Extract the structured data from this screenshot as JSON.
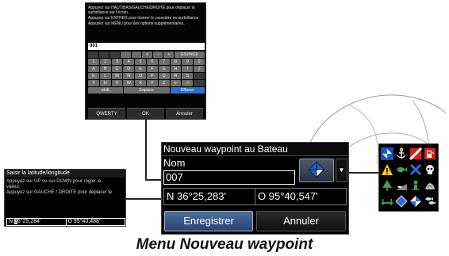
{
  "keyboard_panel": {
    "help": [
      "Appuyez sur HAUT/BAS/GAUCHE/DROITE pour déplacer la surbrillance sur l'écran.",
      "Appuyez sur ENTRER pour insérer le caractère en surbrillance.",
      "Appuyez sur MENU pour des options supplémentaires."
    ],
    "input_value": "001",
    "rows": [
      [
        ".",
        "-",
        "+",
        ":",
        "+",
        "ESPACE"
      ],
      [
        "1",
        "2",
        "3",
        "4",
        "5",
        "6",
        "7",
        "8",
        "9",
        "0"
      ],
      [
        "A",
        "B",
        "C",
        "D",
        "E",
        "F",
        "G",
        "H",
        "I",
        "J"
      ],
      [
        "K",
        "L",
        "M",
        "N",
        "O",
        "P",
        "Q",
        "R",
        "S"
      ],
      [
        "T",
        "U",
        "V",
        "W",
        "X",
        "Y",
        "Z",
        "<-",
        "->"
      ]
    ],
    "bottom_row": {
      "shift": "shift",
      "space": "Espace",
      "erase": "Effacer"
    },
    "buttons": {
      "qwerty": "QWERTY",
      "ok": "OK",
      "cancel": "Annuler"
    }
  },
  "dialog": {
    "title": "Nouveau waypoint au Bateau",
    "name_label": "Nom",
    "name_value": "007",
    "icon_name": "waypoint-diamond-icon",
    "latitude": "N   36°25,283'",
    "longitude": "O   95°40,547'",
    "save_label": "Enregistrer",
    "cancel_label": "Annuler"
  },
  "latlong_panel": {
    "title": "Saisir la latitude/longitude",
    "help": [
      "Appuyez sur UP ou sur DOWN pour régler la",
      "valeur.",
      "Appuyez sur GAUCHE / DROITE pour déplacer le"
    ],
    "lat_prefix": "N  ",
    "lat_cursor": "3",
    "lat_rest": "6°25,284'",
    "longitude": "O   95°40,488'"
  },
  "icon_palette": {
    "icons": [
      "waypoint-diamond-icon",
      "anchor-icon",
      "flag-red-icon",
      "fuel-icon",
      "caution-icon",
      "fish-icon",
      "x-mark-icon",
      "skull-icon",
      "tree-icon",
      "boat-ramp-icon",
      "diver-icon",
      "rock-icon",
      "dock-icon",
      "blue-diamond-icon",
      "diamond-dot-icon",
      "fish-school-icon"
    ]
  },
  "caption": "Menu Nouveau waypoint",
  "colors": {
    "accent_blue": "#2a6fd6",
    "button_blue": "#3a5a8a",
    "panel_black": "#000000"
  }
}
